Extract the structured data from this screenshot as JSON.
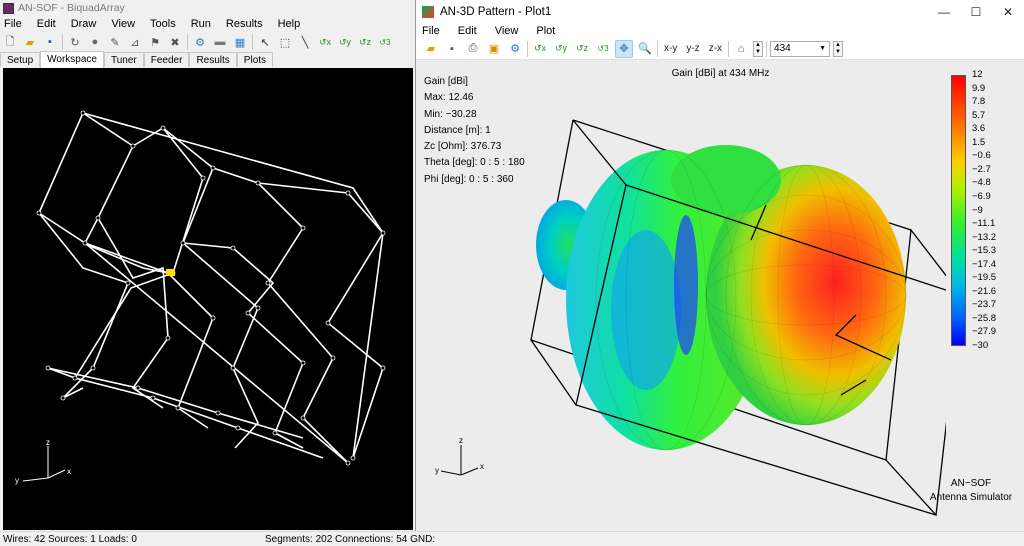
{
  "main_window": {
    "title": "AN-SOF - BiquadArray",
    "menu": [
      "File",
      "Edit",
      "Draw",
      "View",
      "Tools",
      "Run",
      "Results",
      "Help"
    ],
    "tabs": [
      "Setup",
      "Workspace",
      "Tuner",
      "Feeder",
      "Results",
      "Plots"
    ],
    "active_tab": "Workspace",
    "axes": {
      "z": "z",
      "y": "y",
      "x": "x"
    }
  },
  "status": {
    "left": "Wires: 42  Sources: 1  Loads: 0",
    "right": "Segments: 202  Connections: 54  GND:"
  },
  "pattern_window": {
    "title": "AN-3D Pattern - Plot1",
    "controls": {
      "minimize": "—",
      "maximize": "☐",
      "close": "✕"
    },
    "menu": [
      "File",
      "Edit",
      "View",
      "Plot"
    ],
    "view_buttons": [
      "x-y",
      "y-z",
      "z-x"
    ],
    "frequency": "434",
    "plot_title": "Gain [dBi] at 434 MHz",
    "info": [
      "Gain [dBi]",
      "Max: 12.46",
      "Min: −30.28",
      "Distance [m]: 1",
      "Zc [Ohm]: 376.73",
      "Theta [deg]: 0 : 5 : 180",
      "Phi [deg]: 0 : 5 : 360"
    ],
    "colorbar_ticks": [
      "12",
      "9.9",
      "7.8",
      "5.7",
      "3.6",
      "1.5",
      "−0.6",
      "−2.7",
      "−4.8",
      "−6.9",
      "−9",
      "−11.1",
      "−13.2",
      "−15.3",
      "−17.4",
      "−19.5",
      "−21.6",
      "−23.7",
      "−25.8",
      "−27.9",
      "−30"
    ],
    "axes": {
      "z": "z",
      "y": "y",
      "x": "x"
    },
    "brand_line1": "AN−SOF",
    "brand_line2": "Antenna Simulator"
  }
}
